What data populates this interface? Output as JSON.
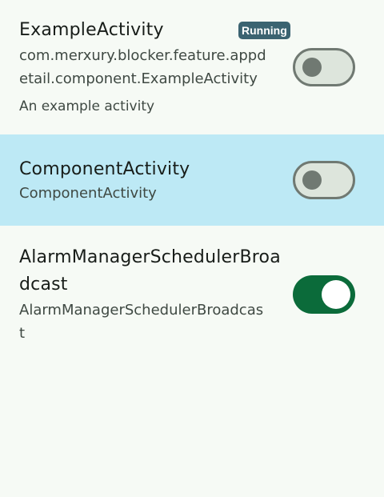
{
  "components": [
    {
      "name": "ExampleActivity",
      "badge": "Running",
      "package_line1": "com.merxury.blocker.feature.appd",
      "package_line2": "etail.component.ExampleActivity",
      "description": "An example activity",
      "enabled": false,
      "selected": false
    },
    {
      "name": "ComponentActivity",
      "package_line1": "ComponentActivity",
      "enabled": false,
      "selected": true
    },
    {
      "name_line1": "AlarmManagerSchedulerBroa",
      "name_line2": "dcast",
      "package_line1": "AlarmManagerSchedulerBroadcas",
      "package_line2": "t",
      "enabled": true,
      "selected": false
    }
  ],
  "colors": {
    "background": "#f6faf5",
    "selected_row": "#bde9f5",
    "badge": "#3b6371",
    "switch_on": "#0b6b3a",
    "switch_off_track": "#dde5dc",
    "switch_off_outline": "#707972"
  }
}
